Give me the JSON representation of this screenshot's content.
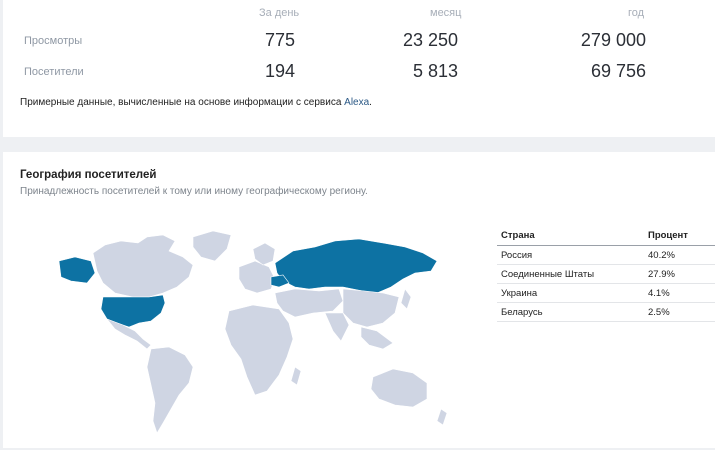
{
  "traffic": {
    "columns": [
      "За день",
      "месяц",
      "год"
    ],
    "rows": [
      {
        "label": "Просмотры",
        "values": [
          "775",
          "23 250",
          "279 000"
        ]
      },
      {
        "label": "Посетители",
        "values": [
          "194",
          "5 813",
          "69 756"
        ]
      }
    ],
    "note_text": "Примерные данные, вычисленные на основе информации с сервиса ",
    "note_link": "Alexa",
    "note_end": "."
  },
  "geo": {
    "title": "География посетителей",
    "subtitle": "Принадлежность посетителей к тому или иному географическому региону.",
    "table": {
      "headers": [
        "Страна",
        "Процент"
      ],
      "rows": [
        {
          "country": "Россия",
          "percent": "40.2%"
        },
        {
          "country": "Соединенные Штаты",
          "percent": "27.9%"
        },
        {
          "country": "Украина",
          "percent": "4.1%"
        },
        {
          "country": "Беларусь",
          "percent": "2.5%"
        }
      ]
    },
    "map_colors": {
      "land": "#cfd5e3",
      "highlight": "#0d72a3"
    }
  }
}
